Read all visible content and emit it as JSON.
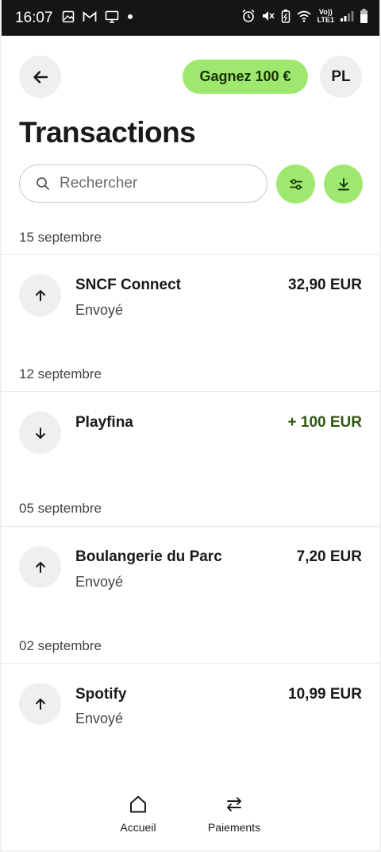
{
  "status_bar": {
    "time": "16:07",
    "network_line1": "Vo))",
    "network_line2": "LTE1"
  },
  "header": {
    "promo_label": "Gagnez 100 €",
    "avatar_initials": "PL",
    "title": "Transactions"
  },
  "search": {
    "placeholder": "Rechercher"
  },
  "groups": [
    {
      "date": "15 septembre",
      "name": "SNCF Connect",
      "status": "Envoyé",
      "amount": "32,90 EUR",
      "direction": "outgoing"
    },
    {
      "date": "12 septembre",
      "name": "Playfina",
      "status": "",
      "amount": "+ 100 EUR",
      "direction": "incoming"
    },
    {
      "date": "05 septembre",
      "name": "Boulangerie du Parc",
      "status": "Envoyé",
      "amount": "7,20 EUR",
      "direction": "outgoing"
    },
    {
      "date": "02 septembre",
      "name": "Spotify",
      "status": "Envoyé",
      "amount": "10,99 EUR",
      "direction": "outgoing"
    }
  ],
  "bottom_nav": {
    "home_label": "Accueil",
    "payments_label": "Paiements"
  },
  "colors": {
    "accent_green": "#9fe870",
    "incoming_amount": "#2f5711",
    "status_bar": "#151515"
  },
  "icons": {
    "back": "arrow-left-icon",
    "search": "search-icon",
    "filter": "filter-sliders-icon",
    "download": "download-icon",
    "outgoing": "arrow-up-icon",
    "incoming": "arrow-down-icon",
    "home": "home-icon",
    "payments": "transfer-arrows-icon"
  }
}
